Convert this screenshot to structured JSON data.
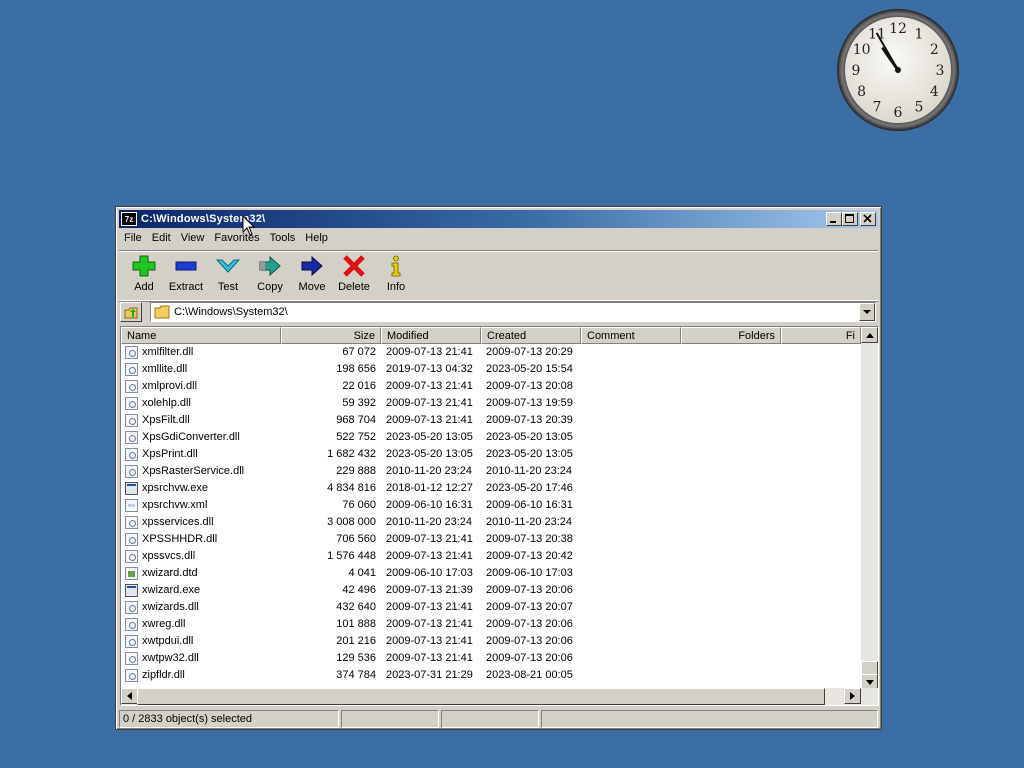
{
  "clock": {
    "numbers": [
      "12",
      "1",
      "2",
      "3",
      "4",
      "5",
      "6",
      "7",
      "8",
      "9",
      "10",
      "11"
    ],
    "hour_hand_angle_deg": -35,
    "minute_hand_angle_deg": -30
  },
  "window": {
    "title": "C:\\Windows\\System32\\",
    "app_icon_text": "7z",
    "minimize_icon": "minimize-icon",
    "maximize_icon": "maximize-icon",
    "close_icon": "close-icon"
  },
  "menu": [
    "File",
    "Edit",
    "View",
    "Favorites",
    "Tools",
    "Help"
  ],
  "toolbar": [
    {
      "label": "Add",
      "icon": "plus-icon",
      "color": "#22bb22"
    },
    {
      "label": "Extract",
      "icon": "minus-icon",
      "color": "#1a3fd0"
    },
    {
      "label": "Test",
      "icon": "check-icon",
      "color": "#2ab0c8"
    },
    {
      "label": "Copy",
      "icon": "copy-arrow-icon",
      "color": "#28a090"
    },
    {
      "label": "Move",
      "icon": "move-arrow-icon",
      "color": "#1a2aa0"
    },
    {
      "label": "Delete",
      "icon": "delete-x-icon",
      "color": "#dd1111"
    },
    {
      "label": "Info",
      "icon": "info-icon",
      "color": "#e8d000"
    }
  ],
  "address": {
    "path": "C:\\Windows\\System32\\"
  },
  "columns": [
    "Name",
    "Size",
    "Modified",
    "Created",
    "Comment",
    "Folders",
    "Fi"
  ],
  "files": [
    {
      "name": "xmlfilter.dll",
      "type": "dll",
      "size": "67 072",
      "modified": "2009-07-13 21:41",
      "created": "2009-07-13 20:29"
    },
    {
      "name": "xmllite.dll",
      "type": "dll",
      "size": "198 656",
      "modified": "2019-07-13 04:32",
      "created": "2023-05-20 15:54"
    },
    {
      "name": "xmlprovi.dll",
      "type": "dll",
      "size": "22 016",
      "modified": "2009-07-13 21:41",
      "created": "2009-07-13 20:08"
    },
    {
      "name": "xolehlp.dll",
      "type": "dll",
      "size": "59 392",
      "modified": "2009-07-13 21:41",
      "created": "2009-07-13 19:59"
    },
    {
      "name": "XpsFilt.dll",
      "type": "dll",
      "size": "968 704",
      "modified": "2009-07-13 21:41",
      "created": "2009-07-13 20:39"
    },
    {
      "name": "XpsGdiConverter.dll",
      "type": "dll",
      "size": "522 752",
      "modified": "2023-05-20 13:05",
      "created": "2023-05-20 13:05"
    },
    {
      "name": "XpsPrint.dll",
      "type": "dll",
      "size": "1 682 432",
      "modified": "2023-05-20 13:05",
      "created": "2023-05-20 13:05"
    },
    {
      "name": "XpsRasterService.dll",
      "type": "dll",
      "size": "229 888",
      "modified": "2010-11-20 23:24",
      "created": "2010-11-20 23:24"
    },
    {
      "name": "xpsrchvw.exe",
      "type": "exe",
      "size": "4 834 816",
      "modified": "2018-01-12 12:27",
      "created": "2023-05-20 17:46"
    },
    {
      "name": "xpsrchvw.xml",
      "type": "xml",
      "size": "76 060",
      "modified": "2009-06-10 16:31",
      "created": "2009-06-10 16:31"
    },
    {
      "name": "xpsservices.dll",
      "type": "dll",
      "size": "3 008 000",
      "modified": "2010-11-20 23:24",
      "created": "2010-11-20 23:24"
    },
    {
      "name": "XPSSHHDR.dll",
      "type": "dll",
      "size": "706 560",
      "modified": "2009-07-13 21:41",
      "created": "2009-07-13 20:38"
    },
    {
      "name": "xpssvcs.dll",
      "type": "dll",
      "size": "1 576 448",
      "modified": "2009-07-13 21:41",
      "created": "2009-07-13 20:42"
    },
    {
      "name": "xwizard.dtd",
      "type": "dtd",
      "size": "4 041",
      "modified": "2009-06-10 17:03",
      "created": "2009-06-10 17:03"
    },
    {
      "name": "xwizard.exe",
      "type": "exe",
      "size": "42 496",
      "modified": "2009-07-13 21:39",
      "created": "2009-07-13 20:06"
    },
    {
      "name": "xwizards.dll",
      "type": "dll",
      "size": "432 640",
      "modified": "2009-07-13 21:41",
      "created": "2009-07-13 20:07"
    },
    {
      "name": "xwreg.dll",
      "type": "dll",
      "size": "101 888",
      "modified": "2009-07-13 21:41",
      "created": "2009-07-13 20:06"
    },
    {
      "name": "xwtpdui.dll",
      "type": "dll",
      "size": "201 216",
      "modified": "2009-07-13 21:41",
      "created": "2009-07-13 20:06"
    },
    {
      "name": "xwtpw32.dll",
      "type": "dll",
      "size": "129 536",
      "modified": "2009-07-13 21:41",
      "created": "2009-07-13 20:06"
    },
    {
      "name": "zipfldr.dll",
      "type": "dll",
      "size": "374 784",
      "modified": "2023-07-31 21:29",
      "created": "2023-08-21 00:05"
    }
  ],
  "status": {
    "selection": "0 / 2833 object(s) selected"
  }
}
